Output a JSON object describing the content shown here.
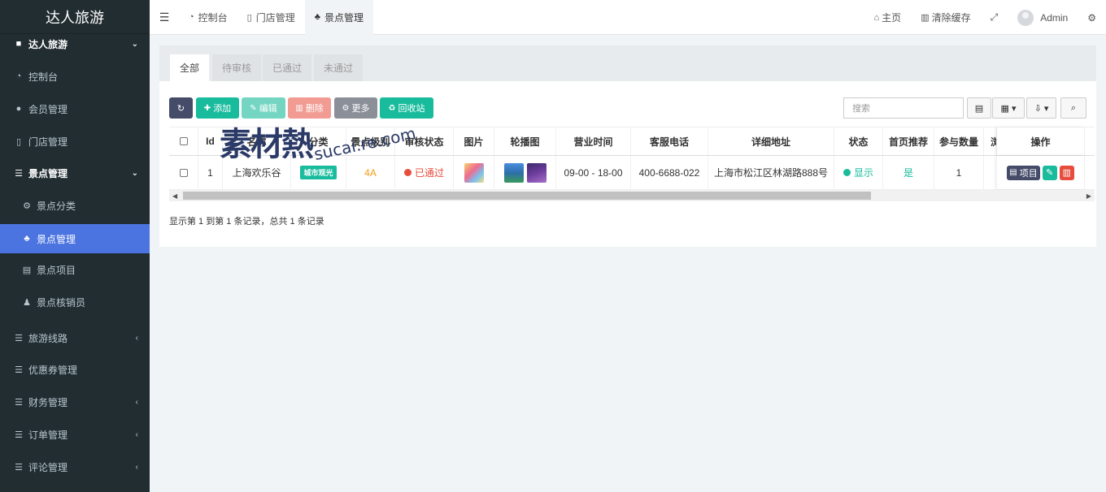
{
  "app": {
    "brand": "达人旅游"
  },
  "sidebar": {
    "items": [
      {
        "label": "达人旅游",
        "icon": "folder-icon"
      },
      {
        "label": "控制台",
        "icon": "dashboard-icon"
      },
      {
        "label": "会员管理",
        "icon": "users-icon"
      },
      {
        "label": "门店管理",
        "icon": "building-icon"
      },
      {
        "label": "景点管理",
        "icon": "list-icon"
      },
      {
        "label": "景点分类",
        "icon": "cogs-icon"
      },
      {
        "label": "景点管理",
        "icon": "tree-icon"
      },
      {
        "label": "景点项目",
        "icon": "card-icon"
      },
      {
        "label": "景点核销员",
        "icon": "user-icon"
      },
      {
        "label": "旅游线路",
        "icon": "list-icon"
      },
      {
        "label": "优惠券管理",
        "icon": "list-icon"
      },
      {
        "label": "财务管理",
        "icon": "list-icon"
      },
      {
        "label": "订单管理",
        "icon": "list-icon"
      },
      {
        "label": "评论管理",
        "icon": "list-icon"
      }
    ]
  },
  "topbar": {
    "tabs": [
      "控制台",
      "门店管理",
      "景点管理"
    ],
    "home": "主页",
    "clear_cache": "清除缓存",
    "user": "Admin"
  },
  "content": {
    "tabs": [
      "全部",
      "待审核",
      "已通过",
      "未通过"
    ],
    "buttons": {
      "add": "添加",
      "edit": "编辑",
      "delete": "删除",
      "more": "更多",
      "recycle": "回收站"
    },
    "search_placeholder": "搜索"
  },
  "table": {
    "columns": [
      "Id",
      "名称",
      "分类",
      "景点级别",
      "审核状态",
      "图片",
      "轮播图",
      "营业时间",
      "客服电话",
      "详细地址",
      "状态",
      "首页推荐",
      "参与数量",
      "浏",
      "操作"
    ],
    "rows": [
      {
        "id": "1",
        "name": "上海欢乐谷",
        "category": "城市观光",
        "level": "4A",
        "audit_status": "已通过",
        "hours": "09-00 - 18-00",
        "phone": "400-6688-022",
        "address": "上海市松江区林湖路888号",
        "status": "显示",
        "recommend": "是",
        "count": "1",
        "op_item": "项目"
      }
    ]
  },
  "footer": {
    "summary": "显示第 1 到第 1 条记录，总共 1 条记录"
  },
  "watermark": {
    "zh": "素材熱",
    "en": "sucai.re.com"
  }
}
